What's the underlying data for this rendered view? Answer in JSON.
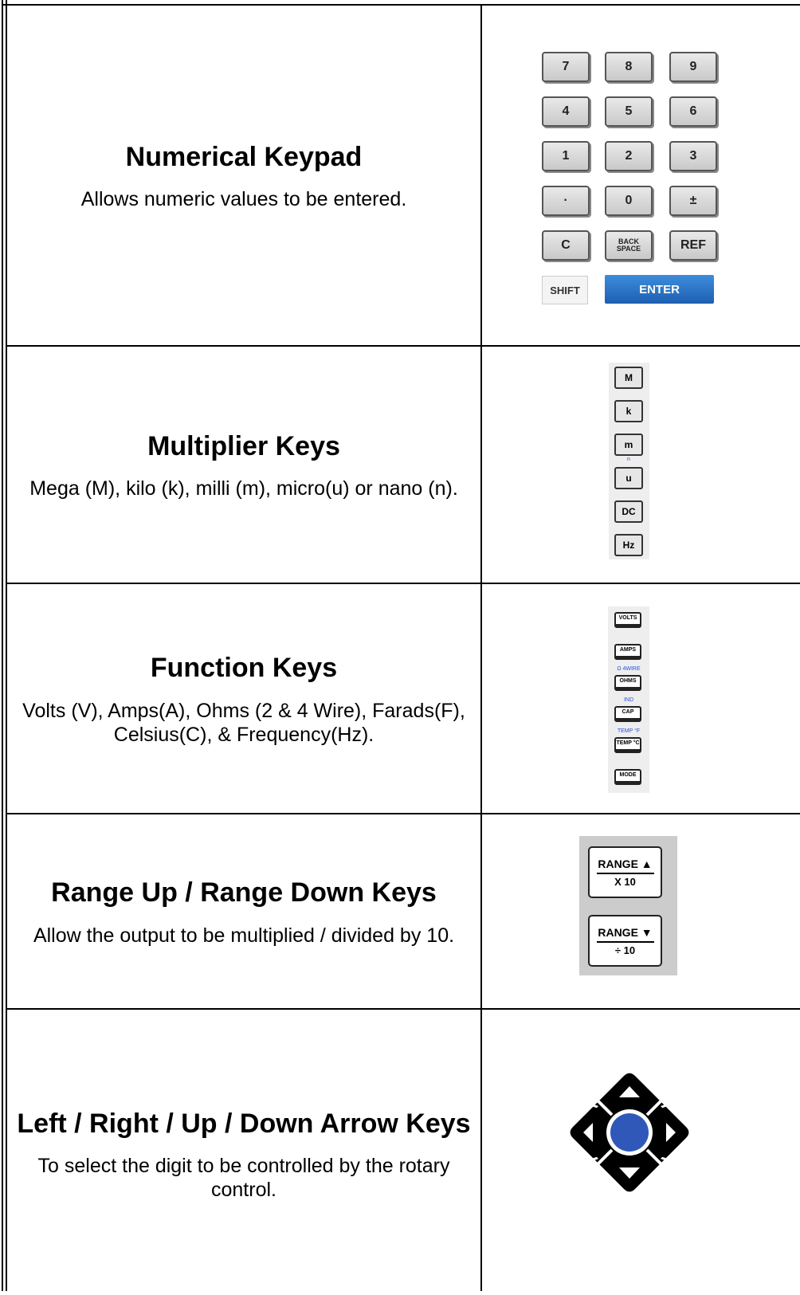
{
  "rows": [
    {
      "title": "Numerical Keypad",
      "description": "Allows numeric values to be entered."
    },
    {
      "title": "Multiplier Keys",
      "description": "Mega (M), kilo (k), milli (m), micro(u) or nano (n)."
    },
    {
      "title": "Function Keys",
      "description": "Volts (V), Amps(A), Ohms (2 & 4 Wire), Farads(F), Celsius(C), & Frequency(Hz)."
    },
    {
      "title": "Range Up / Range Down Keys",
      "description": "Allow the output to be multiplied / divided by 10."
    },
    {
      "title": "Left / Right / Up / Down Arrow Keys",
      "description": "To select the digit to be controlled by the rotary control."
    }
  ],
  "keypad": {
    "keys": [
      "7",
      "8",
      "9",
      "4",
      "5",
      "6",
      "1",
      "2",
      "3",
      "·",
      "0",
      "±",
      "C",
      "BACK SPACE",
      "REF"
    ],
    "shift": "SHIFT",
    "enter": "ENTER"
  },
  "multiplier": {
    "keys": [
      "M",
      "k",
      "m",
      "u",
      "DC",
      "Hz"
    ],
    "alt_label": "n"
  },
  "function_keys": {
    "keys": [
      "VOLTS",
      "AMPS",
      "OHMS",
      "CAP",
      "TEMP °C",
      "MODE"
    ],
    "alt_labels": [
      "Ω 4WIRE",
      "IND",
      "TEMP °F"
    ]
  },
  "range_keys": {
    "up_label": "RANGE ▲",
    "up_sub": "X 10",
    "down_label": "RANGE ▼",
    "down_sub": "÷ 10"
  },
  "colors": {
    "enter": "#1e5fb0",
    "dpad_center": "#2f58b8",
    "alt_label": "#2b4fd0"
  }
}
